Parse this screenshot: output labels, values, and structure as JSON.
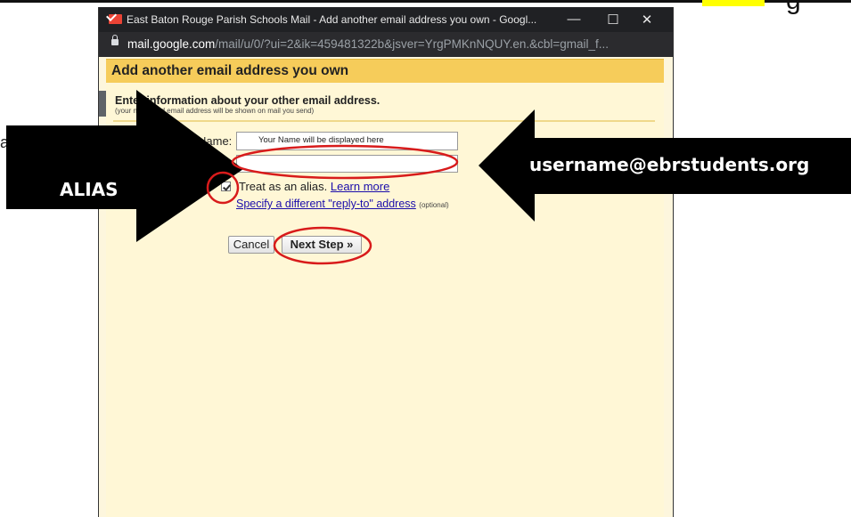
{
  "document": {
    "left_fragment": "ark",
    "top_right_fragment": "g"
  },
  "window": {
    "title": "East Baton Rouge Parish Schools Mail - Add another email address you own - Googl...",
    "controls": {
      "minimize": "—",
      "maximize": "☐",
      "close": "✕"
    },
    "url_host": "mail.google.com",
    "url_path": "/mail/u/0/?ui=2&ik=459481322b&jsver=YrgPMKnNQUY.en.&cbl=gmail_f..."
  },
  "dialog": {
    "heading": "Add another email address you own",
    "intro": "Enter information about your other email address.",
    "intro_sub": "(your name and email address will be shown on mail you send)",
    "name_label": "Name:",
    "name_value": "Your Name will be displayed here",
    "email_label": "ail address:",
    "email_value": "",
    "alias_label": "Treat as an alias.",
    "alias_checked": true,
    "learn_more": "Learn more",
    "reply_to_link": "Specify a different \"reply-to\" address",
    "reply_to_optional": "(optional)",
    "cancel_button": "Cancel",
    "next_button": "Next Step »"
  },
  "annotations": {
    "email_callout": "username@ebrstudents.org",
    "alias_callout": "ALIAS",
    "highlight_color": "#d81b1b",
    "arrow_color": "#000000"
  }
}
